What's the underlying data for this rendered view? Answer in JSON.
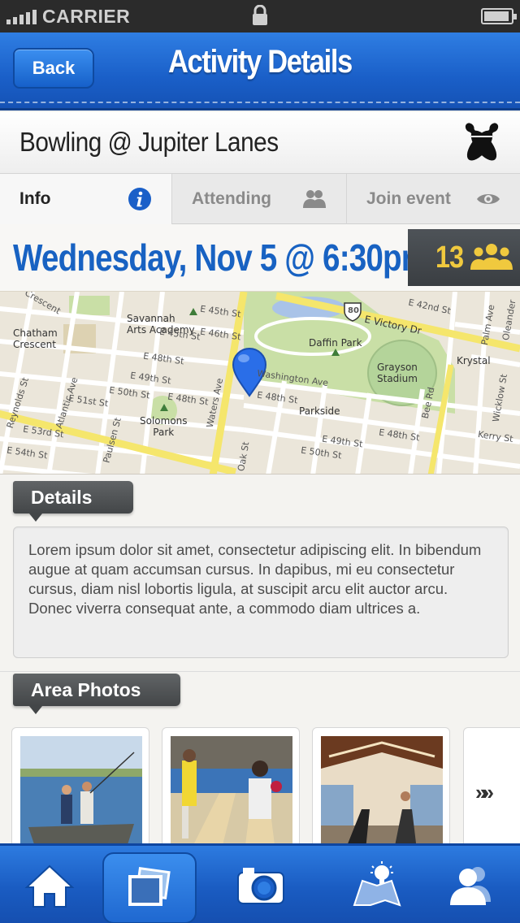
{
  "status_bar": {
    "carrier": "CARRIER"
  },
  "nav": {
    "back_label": "Back",
    "title": "Activity Details"
  },
  "activity": {
    "title": "Bowling @ Jupiter Lanes",
    "icon": "bowling-pins-icon"
  },
  "tabs": [
    {
      "label": "Info",
      "icon": "info-icon",
      "active": true
    },
    {
      "label": "Attending",
      "icon": "people-icon",
      "active": false
    },
    {
      "label": "Join event",
      "icon": "eye-icon",
      "active": false
    }
  ],
  "event": {
    "datetime": "Wednesday, Nov 5 @ 6:30pm",
    "attendee_count": "13"
  },
  "map": {
    "labels": {
      "chatham": "Chatham\nCrescent",
      "savannah": "Savannah\nArts Academy",
      "e45th_a": "E 45th St",
      "e45th_b": "E 45th St",
      "e46th": "E 46th St",
      "e48th_a": "E 48th St",
      "e48th_b": "E 48th St",
      "e48th_c": "E 48th St",
      "e48th_d": "E 48th St",
      "e49th_a": "E 49th St",
      "e49th_b": "E 49th St",
      "e50th_a": "E 50th St",
      "e50th_b": "E 50th St",
      "e51st": "E 51st St",
      "e53rd": "E 53rd St",
      "e54th": "E 54th St",
      "e42nd": "E 42nd St",
      "victory": "E Victory Dr",
      "daffin": "Daffin Park",
      "grayson": "Grayson\nStadium",
      "krystal": "Krystal",
      "washington": "Washington Ave",
      "parkside": "Parkside",
      "solomons": "Solomons\nPark",
      "waters": "Waters Ave",
      "atlantic": "Atlantic Ave",
      "paulsen": "Paulsen St",
      "reynolds": "Reynolds St",
      "oak": "Oak St",
      "bee": "Bee Rd",
      "palm": "Palm Ave",
      "oleander": "Oleander",
      "wicklow": "Wicklow St",
      "kerry": "Kerry St",
      "crescent": "Crescent",
      "route": "80"
    }
  },
  "details": {
    "heading": "Details",
    "body": "Lorem ipsum dolor sit amet, consectetur adipiscing elit. In bibendum augue at quam accumsan cursus. In dapibus, mi eu consectetur cursus, diam nisl lobortis ligula, at suscipit arcu elit auctor arcu. Donec viverra consequat ante, a commodo diam ultrices a."
  },
  "photos": {
    "heading": "Area Photos",
    "items": [
      "fishing-boat-photo",
      "bowling-alley-photo",
      "gym-photo"
    ],
    "more_label": "»»"
  },
  "tab_bar": [
    {
      "icon": "home-icon",
      "active": false
    },
    {
      "icon": "photos-icon",
      "active": true
    },
    {
      "icon": "camera-icon",
      "active": false
    },
    {
      "icon": "map-idea-icon",
      "active": false
    },
    {
      "icon": "profile-icon",
      "active": false
    }
  ],
  "colors": {
    "brand_blue": "#1a5fc8",
    "date_blue": "#1862c2",
    "badge_yellow": "#f0c93e"
  }
}
